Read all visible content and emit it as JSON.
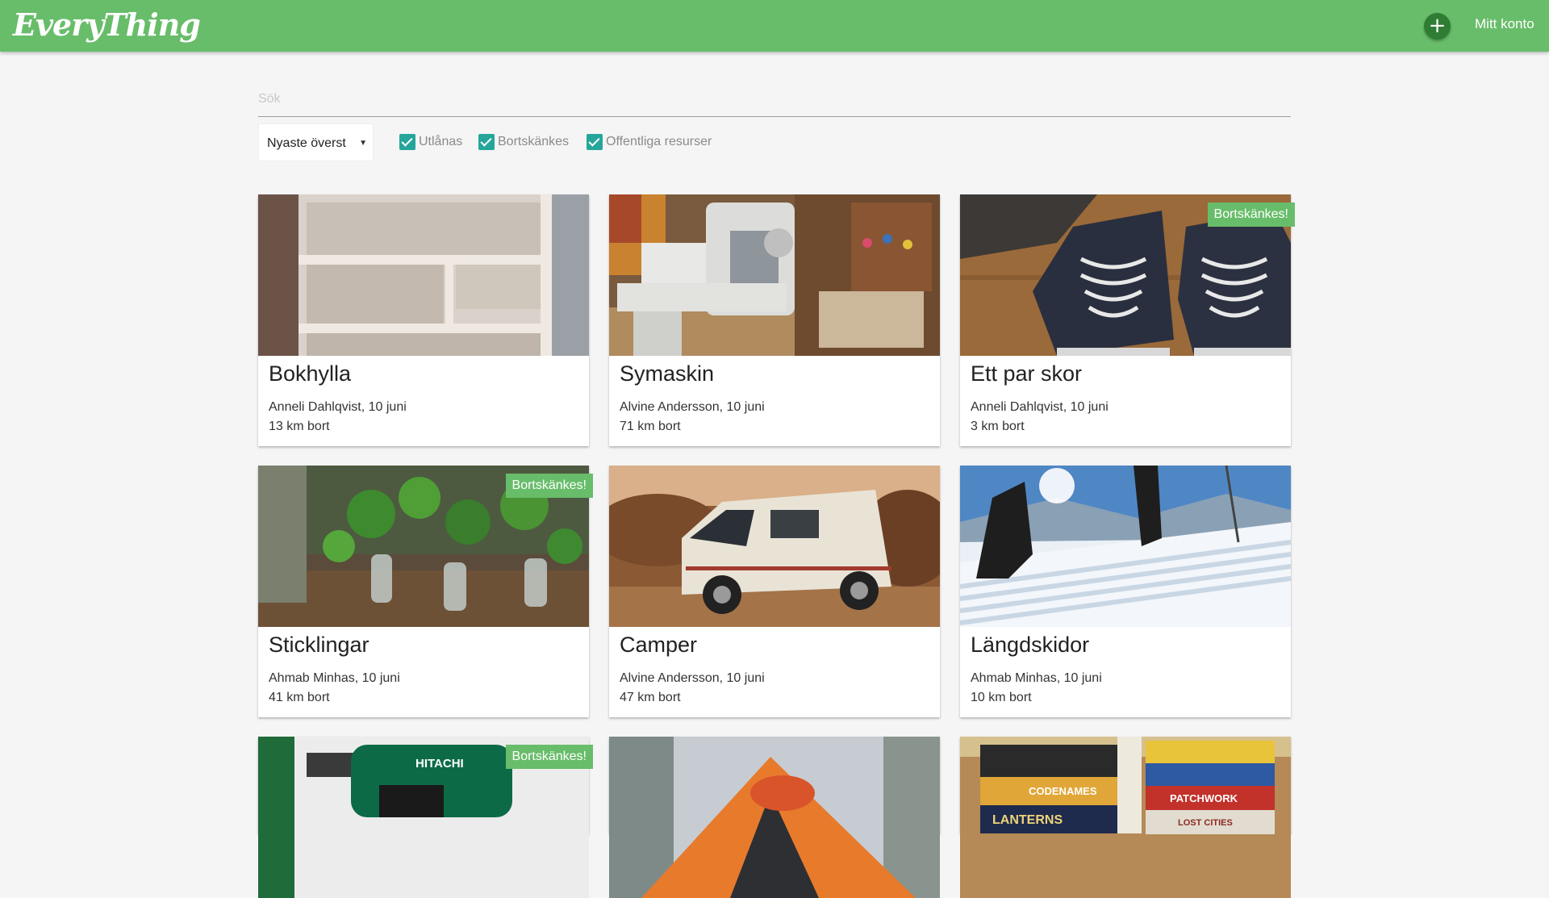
{
  "header": {
    "logo": "EveryThing",
    "add_icon": "plus-icon",
    "account_label": "Mitt konto",
    "bg_color": "#68bd6a"
  },
  "search": {
    "placeholder": "Sök",
    "value": ""
  },
  "filters": {
    "sort_selected": "Nyaste överst",
    "checkboxes": [
      {
        "label": "Utlånas",
        "checked": true
      },
      {
        "label": "Bortskänkes",
        "checked": true
      },
      {
        "label": "Offentliga resurser",
        "checked": true
      }
    ],
    "check_color": "#26a69a"
  },
  "items": [
    {
      "title": "Bokhylla",
      "owner_date": "Anneli Dahlqvist, 10 juni",
      "distance": "13 km bort",
      "badge": "",
      "image": "bookshelf"
    },
    {
      "title": "Symaskin",
      "owner_date": "Alvine Andersson, 10 juni",
      "distance": "71 km bort",
      "badge": "",
      "image": "sewing-machine"
    },
    {
      "title": "Ett par skor",
      "owner_date": "Anneli Dahlqvist, 10 juni",
      "distance": "3 km bort",
      "badge": "Bortskänkes!",
      "image": "shoes"
    },
    {
      "title": "Sticklingar",
      "owner_date": "Ahmab Minhas, 10 juni",
      "distance": "41 km bort",
      "badge": "Bortskänkes!",
      "image": "plant-cuttings"
    },
    {
      "title": "Camper",
      "owner_date": "Alvine Andersson, 10 juni",
      "distance": "47 km bort",
      "badge": "",
      "image": "camper-van"
    },
    {
      "title": "Längdskidor",
      "owner_date": "Ahmab Minhas, 10 juni",
      "distance": "10 km bort",
      "badge": "",
      "image": "cross-country-skis"
    },
    {
      "title": "",
      "owner_date": "",
      "distance": "",
      "badge": "Bortskänkes!",
      "image": "drill",
      "brand": "HITACHI"
    },
    {
      "title": "",
      "owner_date": "",
      "distance": "",
      "badge": "",
      "image": "tent"
    },
    {
      "title": "",
      "owner_date": "",
      "distance": "",
      "badge": "",
      "image": "board-games",
      "box_labels": [
        "CODENAMES",
        "PATCHWORK",
        "LANTERNS",
        "LOST CITIES"
      ]
    }
  ]
}
